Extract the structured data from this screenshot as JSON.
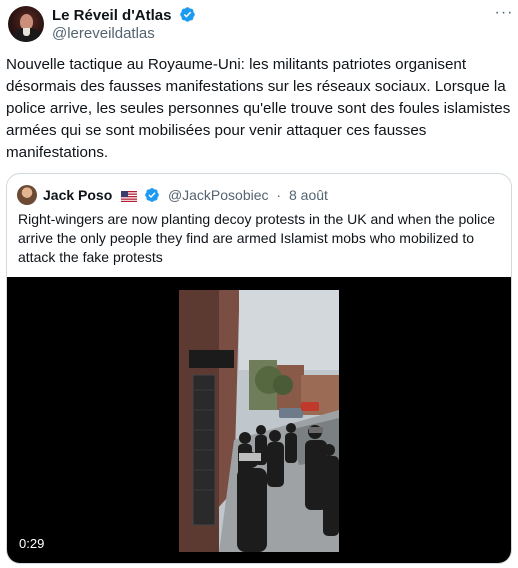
{
  "author": {
    "display_name": "Le Réveil d'Atlas",
    "handle": "@lereveildatlas",
    "avatar_icon": "profile-avatar",
    "verified": true
  },
  "tweet": {
    "text": "Nouvelle tactique au Royaume-Uni: les militants patriotes organisent désormais des fausses manifestations sur les réseaux sociaux. Lorsque la police arrive, les seules personnes qu'elle trouve sont des foules islamistes armées qui se sont mobilisées pour venir attaquer ces fausses manifestations.",
    "more_label": "···"
  },
  "quoted": {
    "display_name": "Jack Poso",
    "flag_icon": "us-flag-icon",
    "handle": "@JackPosobiec",
    "separator": "·",
    "date": "8 août",
    "text": "Right-wingers are now planting decoy protests in the UK and when the police arrive the only people they find are armed Islamist mobs who mobilized to attack the fake protests",
    "media": {
      "type": "video",
      "duration": "0:29"
    }
  },
  "colors": {
    "verified_blue": "#1d9bf0",
    "secondary_text": "#536471",
    "border": "#cfd9de",
    "text": "#0f1419"
  }
}
